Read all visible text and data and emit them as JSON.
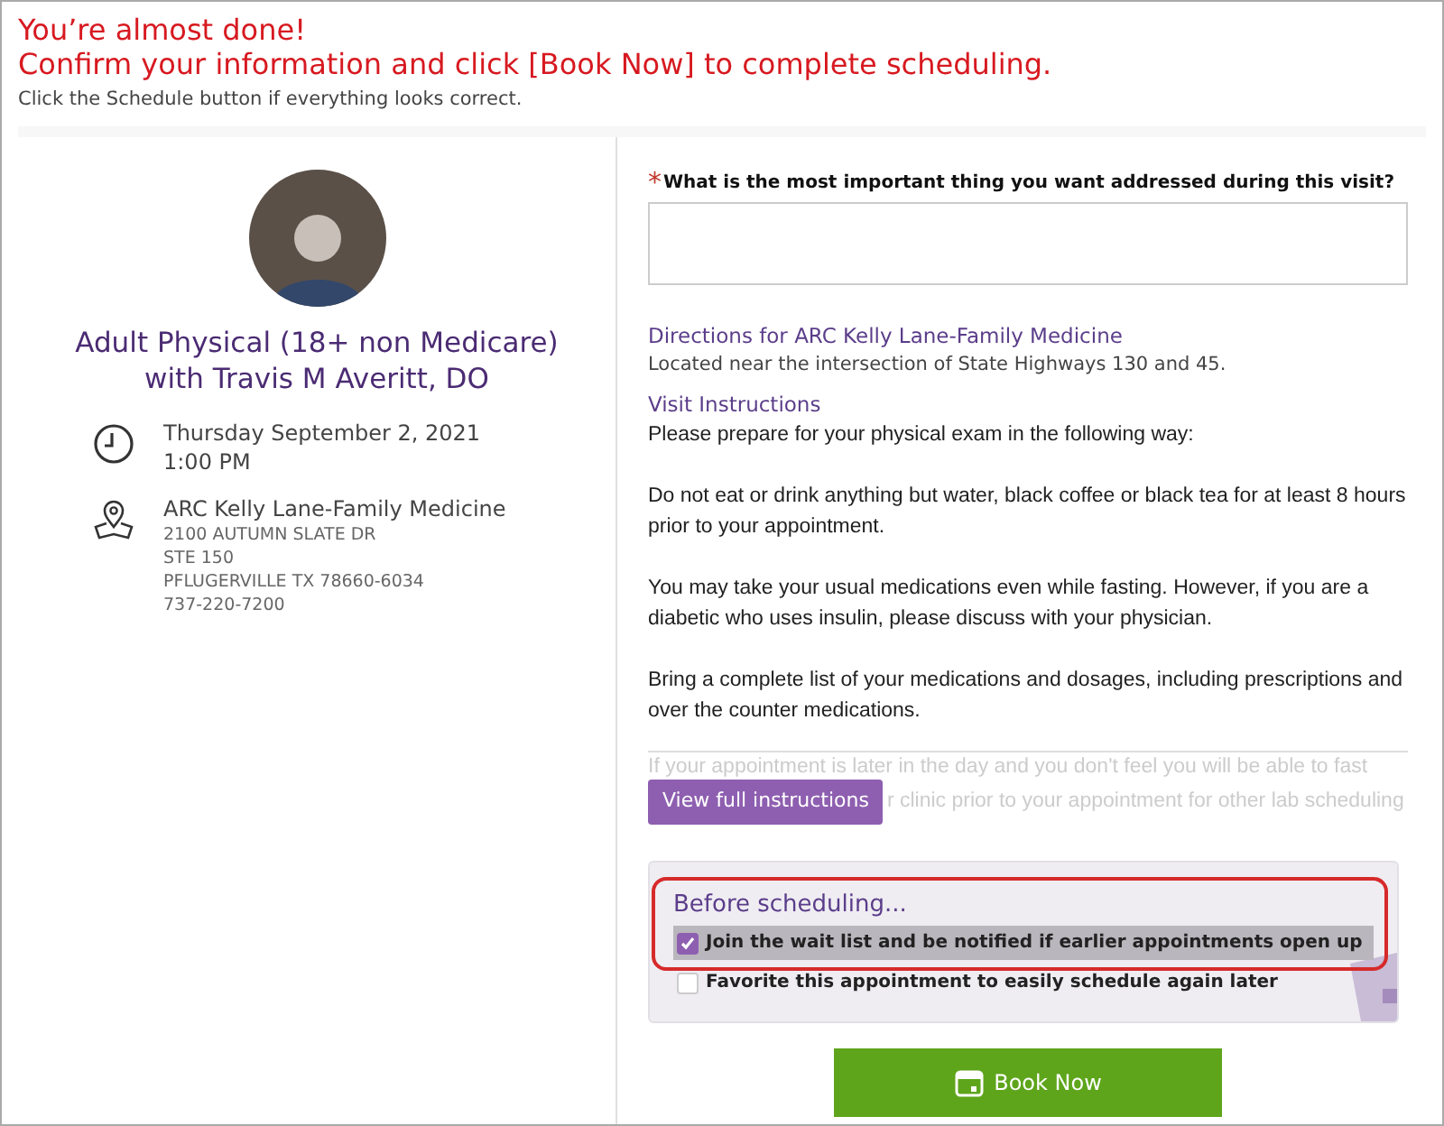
{
  "header": {
    "title_lines": [
      "You’re almost done!",
      "Confirm your information and click [Book Now] to complete scheduling."
    ],
    "subtitle": "Click the Schedule button if everything looks correct."
  },
  "appointment": {
    "title_lines": [
      "Adult Physical (18+ non Medicare)",
      "with Travis M Averitt, DO"
    ],
    "when": {
      "date": "Thursday September 2, 2021",
      "time": "1:00 PM"
    },
    "where": {
      "name": "ARC Kelly Lane-Family Medicine",
      "lines": [
        "2100 AUTUMN SLATE DR",
        "STE 150",
        "PFLUGERVILLE TX 78660-6034",
        "737-220-7200"
      ]
    }
  },
  "question": {
    "required_mark": "*",
    "label": "What is the most important thing you want addressed during this visit?"
  },
  "directions": {
    "title": "Directions for ARC Kelly Lane-Family Medicine",
    "text": "Located near the intersection of State Highways 130 and 45."
  },
  "instructions": {
    "title": "Visit Instructions",
    "paragraphs": [
      "Please prepare for your physical exam in the following way:",
      "Do not eat or drink anything but water, black coffee or black tea for at least 8 hours prior to your appointment.",
      "You may take your usual medications even while fasting. However, if you are a diabetic who uses insulin, please discuss with your physician.",
      "Bring a complete list of your medications and dosages, including prescriptions and over the counter medications."
    ],
    "faded_lines": [
      "If your appointment is later in the day and you don't feel you will be able to fast",
      "r clinic prior to your appointment for other lab scheduling"
    ],
    "button": "View full instructions"
  },
  "before": {
    "title": "Before scheduling...",
    "options": [
      {
        "label": "Join the wait list and be notified if earlier appointments open up",
        "checked": true,
        "highlighted": true
      },
      {
        "label": "Favorite this appointment to easily schedule again later",
        "checked": false,
        "highlighted": false
      }
    ]
  },
  "book_button": "Book Now"
}
